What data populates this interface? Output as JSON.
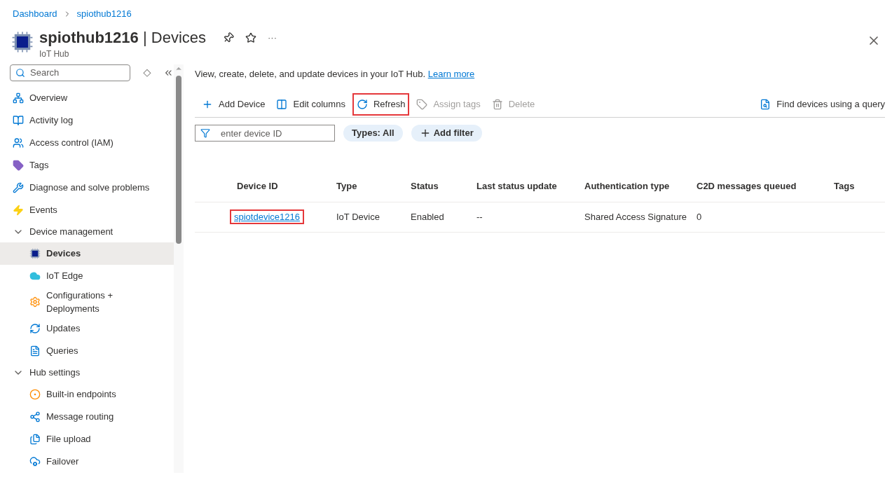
{
  "breadcrumb": [
    "Dashboard",
    "spiothub1216"
  ],
  "header": {
    "title": "spiothub1216",
    "separator": "|",
    "section": "Devices",
    "subtitle": "IoT Hub",
    "more": "···"
  },
  "sidebar": {
    "search_placeholder": "Search",
    "items": [
      {
        "kind": "item",
        "label": "Overview",
        "selected": false
      },
      {
        "kind": "item",
        "label": "Activity log",
        "selected": false
      },
      {
        "kind": "item",
        "label": "Access control (IAM)",
        "selected": false
      },
      {
        "kind": "item",
        "label": "Tags",
        "selected": false
      },
      {
        "kind": "item",
        "label": "Diagnose and solve problems",
        "selected": false
      },
      {
        "kind": "item",
        "label": "Events",
        "selected": false
      },
      {
        "kind": "group",
        "label": "Device management",
        "expanded": true,
        "children": [
          {
            "label": "Devices",
            "selected": true
          },
          {
            "label": "IoT Edge",
            "selected": false
          },
          {
            "label": "Configurations + Deployments",
            "selected": false
          },
          {
            "label": "Updates",
            "selected": false
          },
          {
            "label": "Queries",
            "selected": false
          }
        ]
      },
      {
        "kind": "group",
        "label": "Hub settings",
        "expanded": true,
        "children": [
          {
            "label": "Built-in endpoints",
            "selected": false
          },
          {
            "label": "Message routing",
            "selected": false
          },
          {
            "label": "File upload",
            "selected": false
          },
          {
            "label": "Failover",
            "selected": false
          }
        ]
      }
    ]
  },
  "description": {
    "text": "View, create, delete, and update devices in your IoT Hub.",
    "link": "Learn more"
  },
  "toolbar": [
    {
      "label": "Add Device",
      "disabled": false,
      "highlighted": false
    },
    {
      "label": "Edit columns",
      "disabled": false,
      "highlighted": false
    },
    {
      "label": "Refresh",
      "disabled": false,
      "highlighted": true
    },
    {
      "label": "Assign tags",
      "disabled": true,
      "highlighted": false
    },
    {
      "label": "Delete",
      "disabled": true,
      "highlighted": false
    }
  ],
  "query_button": "Find devices using a query",
  "filter": {
    "placeholder": "enter device ID",
    "pills": [
      "Types: All",
      "Add filter"
    ]
  },
  "table": {
    "columns": [
      "Device ID",
      "Type",
      "Status",
      "Last status update",
      "Authentication type",
      "C2D messages queued",
      "Tags"
    ],
    "rows": [
      {
        "cells": [
          "spiotdevice1216",
          "IoT Device",
          "Enabled",
          "--",
          "Shared Access Signature",
          "0"
        ],
        "highlighted": true
      }
    ]
  }
}
